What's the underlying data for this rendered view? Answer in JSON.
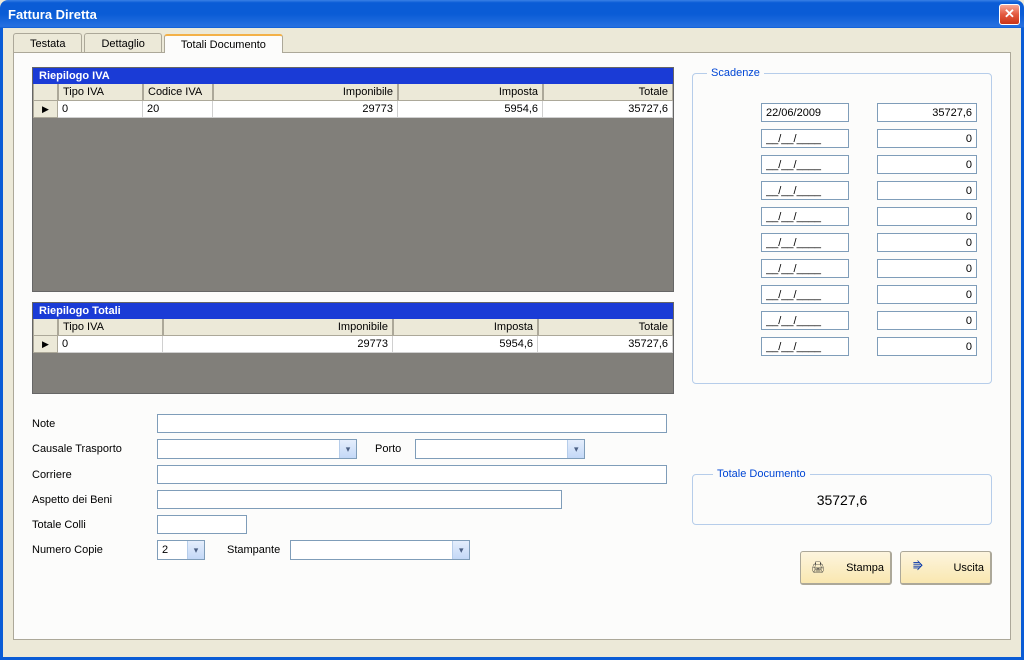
{
  "window": {
    "title": "Fattura Diretta",
    "close_glyph": "✕"
  },
  "tabs": {
    "testata": "Testata",
    "dettaglio": "Dettaglio",
    "totali": "Totali Documento"
  },
  "riepilogoIVA": {
    "title": "Riepilogo IVA",
    "headers": {
      "tipo": "Tipo IVA",
      "codice": "Codice IVA",
      "imp": "Imponibile",
      "impos": "Imposta",
      "tot": "Totale"
    },
    "rows": [
      {
        "marker": "▶",
        "tipo": "0",
        "codice": "20",
        "imp": "29773",
        "impos": "5954,6",
        "tot": "35727,6"
      }
    ]
  },
  "riepilogoTotali": {
    "title": "Riepilogo Totali",
    "headers": {
      "tipo": "Tipo IVA",
      "imp": "Imponibile",
      "impos": "Imposta",
      "tot": "Totale"
    },
    "rows": [
      {
        "marker": "▶",
        "tipo": "0",
        "imp": "29773",
        "impos": "5954,6",
        "tot": "35727,6"
      }
    ]
  },
  "scadenze": {
    "legend": "Scadenze",
    "rows": [
      {
        "date": "22/06/2009",
        "amt": "35727,6"
      },
      {
        "date": "__/__/____",
        "amt": "0"
      },
      {
        "date": "__/__/____",
        "amt": "0"
      },
      {
        "date": "__/__/____",
        "amt": "0"
      },
      {
        "date": "__/__/____",
        "amt": "0"
      },
      {
        "date": "__/__/____",
        "amt": "0"
      },
      {
        "date": "__/__/____",
        "amt": "0"
      },
      {
        "date": "__/__/____",
        "amt": "0"
      },
      {
        "date": "__/__/____",
        "amt": "0"
      },
      {
        "date": "__/__/____",
        "amt": "0"
      }
    ]
  },
  "form": {
    "note": {
      "label": "Note",
      "value": ""
    },
    "causale": {
      "label": "Causale Trasporto",
      "value": ""
    },
    "porto": {
      "label": "Porto",
      "value": ""
    },
    "corriere": {
      "label": "Corriere",
      "value": ""
    },
    "aspetto": {
      "label": "Aspetto dei Beni",
      "value": ""
    },
    "colli": {
      "label": "Totale Colli",
      "value": ""
    },
    "copie": {
      "label": "Numero Copie",
      "value": "2"
    },
    "stampante": {
      "label": "Stampante",
      "value": ""
    }
  },
  "totaleDocumento": {
    "legend": "Totale Documento",
    "value": "35727,6"
  },
  "buttons": {
    "stampa": "Stampa",
    "uscita": "Uscita"
  },
  "glyphs": {
    "dropdown": "▾",
    "printer": "🖨",
    "exit": "⭆"
  }
}
